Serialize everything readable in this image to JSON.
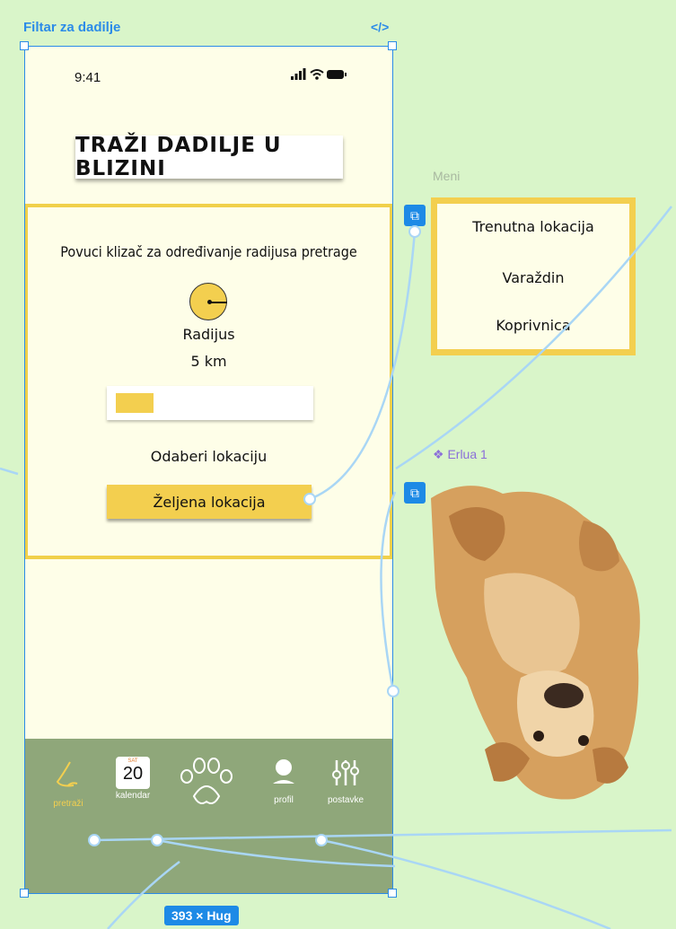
{
  "canvas": {
    "frame_label": "Filtar za dadilje",
    "code_icon": "</>",
    "size_badge": "393 × Hug",
    "menu_caption": "Meni",
    "erlua_caption": "❖ Erlua 1"
  },
  "status_bar": {
    "time": "9:41",
    "icons": "ıl ≋ ▬"
  },
  "screen": {
    "title": "TRAŽI DADILJE U BLIZINI",
    "instruction": "Povuci klizač za određivanje radijusa pretrage",
    "radius_label": "Radijus",
    "radius_value": "5 km",
    "slider_level": 0.2,
    "location_label": "Odaberi lokaciju",
    "location_button": "Željena lokacija"
  },
  "menu": {
    "items": [
      "Trenutna lokacija",
      "Varaždin",
      "Koprivnica"
    ]
  },
  "nav": {
    "items": [
      {
        "label": "pretraži",
        "icon": "search-icon",
        "active": true
      },
      {
        "label": "kalendar",
        "icon": "calendar-icon",
        "active": false
      },
      {
        "label": "",
        "icon": "paw-icon",
        "active": false
      },
      {
        "label": "profil",
        "icon": "profile-icon",
        "active": false
      },
      {
        "label": "postavke",
        "icon": "settings-icon",
        "active": false
      }
    ],
    "calendar_month": "SAT",
    "calendar_day": "20"
  },
  "colors": {
    "accent_yellow": "#f3cf4f",
    "selection_blue": "#2b8be8",
    "canvas_green": "#d9f5c9",
    "nav_green": "#8fa77a",
    "screen_bg": "#fefee8"
  }
}
